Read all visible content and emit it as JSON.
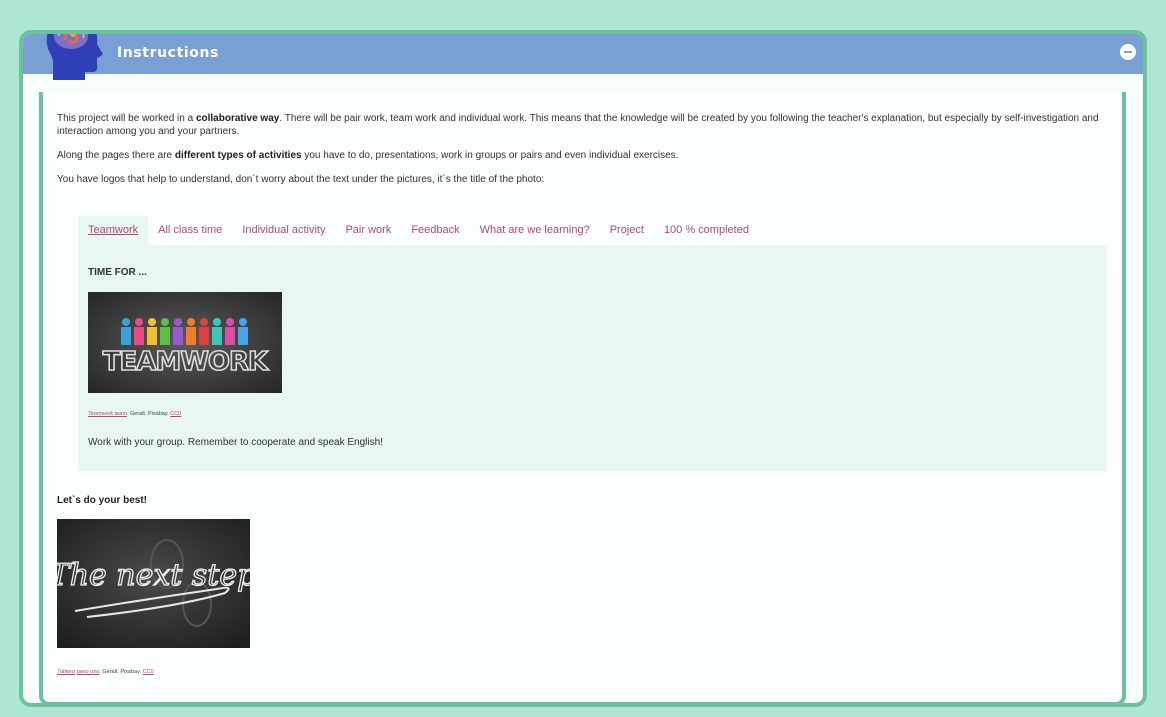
{
  "header": {
    "title": "Instructions",
    "toggle_icon": "minus-circle-icon",
    "logo_icon": "brain-head-icon",
    "colors": {
      "header_bg": "#7a9fd6",
      "border": "#6cc29a",
      "page_bg": "#aee8d4",
      "link": "#b04a78"
    }
  },
  "intro": {
    "p1_before": "This project will be worked in a ",
    "p1_bold": "collaborative way",
    "p1_after": ". There will be pair work, team work and individual work. This means that the knowledge will be created by you following the teacher's explanation, but especially by self-investigation and interaction among you and your partners.",
    "p2_before": "Along the pages there are ",
    "p2_bold": "different types of activities",
    "p2_after": " you have to do, presentations, work in groups or pairs and even individual exercises.",
    "p3": "You have logos that help to understand, don´t worry about the text under the pictures, it´s the title of the photo:"
  },
  "tabs": [
    {
      "label": "Teamwork"
    },
    {
      "label": "All class time"
    },
    {
      "label": "Individual activity"
    },
    {
      "label": "Pair work"
    },
    {
      "label": "Feedback"
    },
    {
      "label": "What are we learning?"
    },
    {
      "label": "Project"
    },
    {
      "label": "100 % completed"
    }
  ],
  "panel": {
    "heading": "TIME FOR ...",
    "image_text": "TEAMWORK",
    "credit_link": "Teamwork team",
    "credit_mid": ". Geralt. Pixabay. ",
    "credit_license": "CC0",
    "text": "Work with your group. Remember to cooperate and speak English!"
  },
  "best": {
    "heading": "Let`s do your best!",
    "image_text": "The next step",
    "credit_link_1": "Tablero",
    "credit_link_2": "paso uno",
    "credit_mid": ". Geralt. Pixabay. ",
    "credit_license": "CC0"
  }
}
